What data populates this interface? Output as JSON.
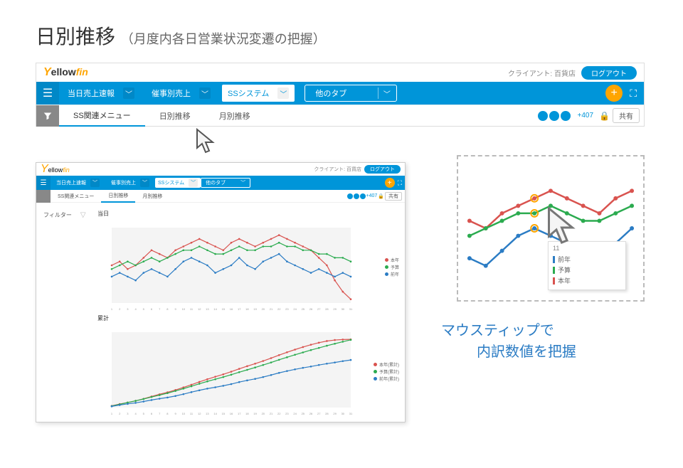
{
  "page": {
    "title": "日別推移",
    "subtitle": "（月度内各日営業状況変遷の把握）"
  },
  "header": {
    "brand_prefix": "ellow",
    "brand_suffix": "fin",
    "client_label": "クライアント: 百貨店",
    "logout": "ログアウト",
    "nav": {
      "item1": "当日売上速報",
      "item2": "催事別売上",
      "item3": "SSシステム",
      "item4": "他のタブ"
    },
    "tabs": {
      "t1": "SS関連メニュー",
      "t2": "日別推移",
      "t3": "月別推移"
    },
    "status_count": "+407",
    "share": "共有"
  },
  "mini": {
    "client_label": "クライアント: 百貨店",
    "logout": "ログアウト",
    "nav": {
      "i1": "当日売上速報",
      "i2": "催事別売上",
      "i3": "SSシステム",
      "i4": "他のタブ"
    },
    "tabs": {
      "t1": "SS関連メニュー",
      "t2": "日別推移",
      "t3": "月別推移"
    },
    "status_count": "+407",
    "share": "共有",
    "filter_label": "フィルター",
    "chart1_title": "当日",
    "chart2_title": "累計",
    "legend1": {
      "a": "本年",
      "b": "予算",
      "c": "前年"
    },
    "legend2": {
      "a": "本年(累計)",
      "b": "予算(累計)",
      "c": "前年(累計)"
    }
  },
  "tooltip": {
    "x_label": "11",
    "row1": "前年",
    "row2": "予算",
    "row3": "本年"
  },
  "annotation": {
    "line1": "マウスティップで",
    "line2": "内訳数値を把握"
  },
  "colors": {
    "brand_blue": "#0095d9",
    "brand_orange": "#ffa500",
    "series_red": "#d9534f",
    "series_green": "#2bab4f",
    "series_blue": "#2b7cc4"
  },
  "chart_data": [
    {
      "type": "line",
      "title": "当日",
      "xlabel": "",
      "ylabel": "",
      "x": [
        1,
        2,
        3,
        4,
        5,
        6,
        7,
        8,
        9,
        10,
        11,
        12,
        13,
        14,
        15,
        16,
        17,
        18,
        19,
        20,
        21,
        22,
        23,
        24,
        25,
        26,
        27,
        28,
        29,
        30,
        31
      ],
      "ylim": [
        0,
        20
      ],
      "series": [
        {
          "name": "本年",
          "color": "#d9534f",
          "values": [
            10,
            11,
            9,
            10,
            12,
            14,
            13,
            12,
            14,
            15,
            16,
            17,
            16,
            15,
            14,
            16,
            17,
            16,
            15,
            16,
            17,
            18,
            17,
            16,
            15,
            14,
            12,
            10,
            6,
            3,
            1
          ]
        },
        {
          "name": "予算",
          "color": "#2bab4f",
          "values": [
            9,
            10,
            11,
            10,
            11,
            12,
            11,
            12,
            13,
            14,
            14,
            15,
            14,
            13,
            13,
            14,
            15,
            14,
            14,
            15,
            15,
            16,
            15,
            15,
            14,
            14,
            13,
            13,
            12,
            12,
            11
          ]
        },
        {
          "name": "前年",
          "color": "#2b7cc4",
          "values": [
            7,
            8,
            7,
            6,
            8,
            9,
            8,
            7,
            9,
            11,
            12,
            11,
            10,
            8,
            9,
            10,
            12,
            10,
            9,
            11,
            12,
            13,
            11,
            10,
            9,
            8,
            9,
            8,
            7,
            8,
            7
          ]
        }
      ]
    },
    {
      "type": "line",
      "title": "累計",
      "xlabel": "",
      "ylabel": "",
      "x": [
        1,
        2,
        3,
        4,
        5,
        6,
        7,
        8,
        9,
        10,
        11,
        12,
        13,
        14,
        15,
        16,
        17,
        18,
        19,
        20,
        21,
        22,
        23,
        24,
        25,
        26,
        27,
        28,
        29,
        30,
        31
      ],
      "ylim": [
        0,
        450
      ],
      "series": [
        {
          "name": "本年(累計)",
          "color": "#d9534f",
          "values": [
            10,
            21,
            30,
            40,
            52,
            66,
            79,
            91,
            105,
            120,
            136,
            153,
            169,
            184,
            198,
            214,
            231,
            247,
            262,
            278,
            295,
            313,
            330,
            346,
            361,
            375,
            387,
            397,
            403,
            406,
            407
          ]
        },
        {
          "name": "予算(累計)",
          "color": "#2bab4f",
          "values": [
            9,
            19,
            30,
            40,
            51,
            63,
            74,
            86,
            99,
            113,
            127,
            142,
            156,
            169,
            182,
            196,
            211,
            225,
            239,
            254,
            269,
            285,
            300,
            315,
            329,
            343,
            356,
            369,
            381,
            393,
            404
          ]
        },
        {
          "name": "前年(累計)",
          "color": "#2b7cc4",
          "values": [
            7,
            15,
            22,
            28,
            36,
            45,
            53,
            60,
            69,
            80,
            92,
            103,
            113,
            121,
            130,
            140,
            152,
            162,
            171,
            182,
            194,
            207,
            218,
            228,
            237,
            245,
            254,
            262,
            269,
            277,
            284
          ]
        }
      ]
    }
  ]
}
